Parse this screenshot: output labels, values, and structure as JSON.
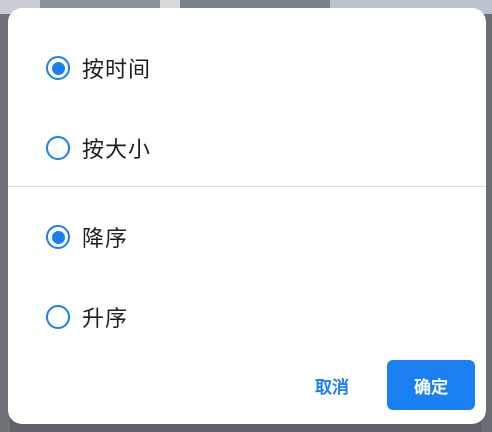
{
  "sort_by": {
    "options": [
      {
        "label": "按时间",
        "checked": true
      },
      {
        "label": "按大小",
        "checked": false
      }
    ]
  },
  "order": {
    "options": [
      {
        "label": "降序",
        "checked": true
      },
      {
        "label": "升序",
        "checked": false
      }
    ]
  },
  "actions": {
    "cancel_label": "取消",
    "confirm_label": "确定"
  },
  "colors": {
    "accent": "#1a7ff0",
    "dialog_bg": "#ffffff",
    "text": "#1e1e1e"
  }
}
